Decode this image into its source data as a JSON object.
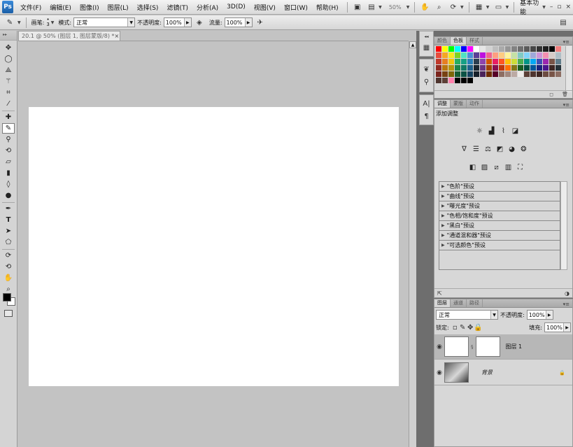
{
  "app": {
    "logo": "Ps"
  },
  "menu": [
    "文件(F)",
    "编辑(E)",
    "图像(I)",
    "图层(L)",
    "选择(S)",
    "滤镜(T)",
    "分析(A)",
    "3D(D)",
    "视图(V)",
    "窗口(W)",
    "帮助(H)"
  ],
  "appbar": {
    "zoom": "50%",
    "workspace": "基本功能",
    "minimize": "–",
    "restore": "▫",
    "close": "×"
  },
  "options": {
    "brush_label": "画笔:",
    "brush_size": "3",
    "mode_label": "模式:",
    "mode_value": "正常",
    "opacity_label": "不透明度:",
    "opacity_value": "100%",
    "flow_label": "流量:",
    "flow_value": "100%"
  },
  "document": {
    "tab_title": "20.1 @ 50% (图层 1, 图层蒙版/8) *",
    "close": "×"
  },
  "swatches_panel": {
    "tabs": [
      "颜色",
      "色板",
      "样式"
    ],
    "active_tab": "色板",
    "colors": [
      "#ff0000",
      "#ffff00",
      "#00ff00",
      "#00ffff",
      "#0000ff",
      "#ff00ff",
      "#ffffff",
      "#e6e6e6",
      "#d2d2d2",
      "#bebebe",
      "#aaaaaa",
      "#969696",
      "#828282",
      "#6e6e6e",
      "#5a5a5a",
      "#464646",
      "#323232",
      "#1e1e1e",
      "#000000",
      "#f08080",
      "#e74c3c",
      "#f5a623",
      "#f8e71c",
      "#7ed321",
      "#50e3c2",
      "#4a90d9",
      "#5b3f96",
      "#bd10e0",
      "#f06292",
      "#ff9e80",
      "#ffcc80",
      "#fff59d",
      "#c5e1a5",
      "#80cbc4",
      "#81d4fa",
      "#9fa8da",
      "#ce93d8",
      "#f48fb1",
      "#d7ccc8",
      "#b0bec5",
      "#c0392b",
      "#e67e22",
      "#f1c40f",
      "#27ae60",
      "#16a085",
      "#2980b9",
      "#2c3e50",
      "#8e44ad",
      "#d35400",
      "#e91e63",
      "#ff5722",
      "#ffc107",
      "#cddc39",
      "#4caf50",
      "#009688",
      "#03a9f4",
      "#3f51b5",
      "#9c27b0",
      "#795548",
      "#607d8b",
      "#922b21",
      "#b9770e",
      "#b7950b",
      "#1e8449",
      "#117a65",
      "#1f618d",
      "#1b2631",
      "#6c3483",
      "#a04000",
      "#880e4f",
      "#bf360c",
      "#ff6f00",
      "#827717",
      "#1b5e20",
      "#004d40",
      "#01579b",
      "#1a237e",
      "#4a148c",
      "#3e2723",
      "#263238",
      "#7b241c",
      "#784212",
      "#7d6608",
      "#145a32",
      "#0b5345",
      "#154360",
      "#17202a",
      "#4a235a",
      "#6e2c00",
      "#560027",
      "#8d6e63",
      "#a1887f",
      "#bcaaa4",
      "#efebe9",
      "#5d4037",
      "#4e342e",
      "#3e2723",
      "#6d4c41",
      "#795548",
      "#8d6e63",
      "#4e342e",
      "#5d4037",
      "#ff80ab",
      "#000000",
      "#000000",
      "#000000"
    ]
  },
  "adjustments_panel": {
    "tabs": [
      "调整",
      "蒙版",
      "动作"
    ],
    "active_tab": "调整",
    "title": "添加调整",
    "presets": [
      "\"色阶\"预设",
      "\"曲线\"预设",
      "\"曝光度\"预设",
      "\"色相/饱和度\"预设",
      "\"黑白\"预设",
      "\"通道混和器\"预设",
      "\"可选颜色\"预设"
    ]
  },
  "layers_panel": {
    "tabs": [
      "图层",
      "通道",
      "路径"
    ],
    "active_tab": "图层",
    "blend_mode": "正常",
    "opacity_label": "不透明度:",
    "opacity_value": "100%",
    "lock_label": "锁定:",
    "fill_label": "填充:",
    "fill_value": "100%",
    "layers": [
      {
        "name": "图层 1",
        "selected": true
      },
      {
        "name": "背景",
        "selected": false
      }
    ]
  },
  "colors": {
    "selected_layer_bg": "#b7b7b7",
    "panel_bg": "#d7d7d7",
    "dark_gutter": "#6e6e6e",
    "workspace_bg": "#c3c3c3"
  }
}
